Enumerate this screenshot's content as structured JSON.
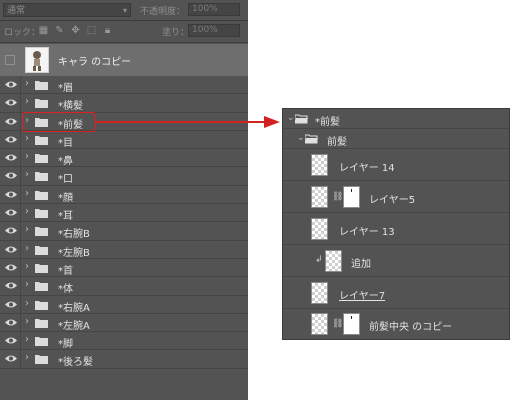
{
  "options": {
    "blend_mode": "通常",
    "opacity_label": "不透明度：",
    "opacity_value": "100%",
    "lock_label": "ロック：",
    "fill_label": "塗り：",
    "fill_value": "100%"
  },
  "selected_layer": {
    "name": "キャラ のコピー"
  },
  "layers": [
    {
      "name": "*眉"
    },
    {
      "name": "*横髪"
    },
    {
      "name": "*前髪"
    },
    {
      "name": "*目"
    },
    {
      "name": "*鼻"
    },
    {
      "name": "*口"
    },
    {
      "name": "*顔"
    },
    {
      "name": "*耳"
    },
    {
      "name": "*右腕B"
    },
    {
      "name": "*左腕B"
    },
    {
      "name": "*首"
    },
    {
      "name": "*体"
    },
    {
      "name": "*右腕A"
    },
    {
      "name": "*左腕A"
    },
    {
      "name": "*脚"
    },
    {
      "name": "*後ろ髪"
    }
  ],
  "expanded": {
    "group": "*前髪",
    "subgroup": "前髪",
    "items": [
      {
        "name": "レイヤー 14"
      },
      {
        "name": "レイヤー5"
      },
      {
        "name": "レイヤー 13"
      },
      {
        "name": "追加"
      },
      {
        "name": "レイヤー7"
      },
      {
        "name": "前髪中央 のコピー"
      }
    ]
  },
  "colors": {
    "panel_bg": "#535353",
    "selected_bg": "#6e6e6e",
    "highlight": "#e02020"
  }
}
